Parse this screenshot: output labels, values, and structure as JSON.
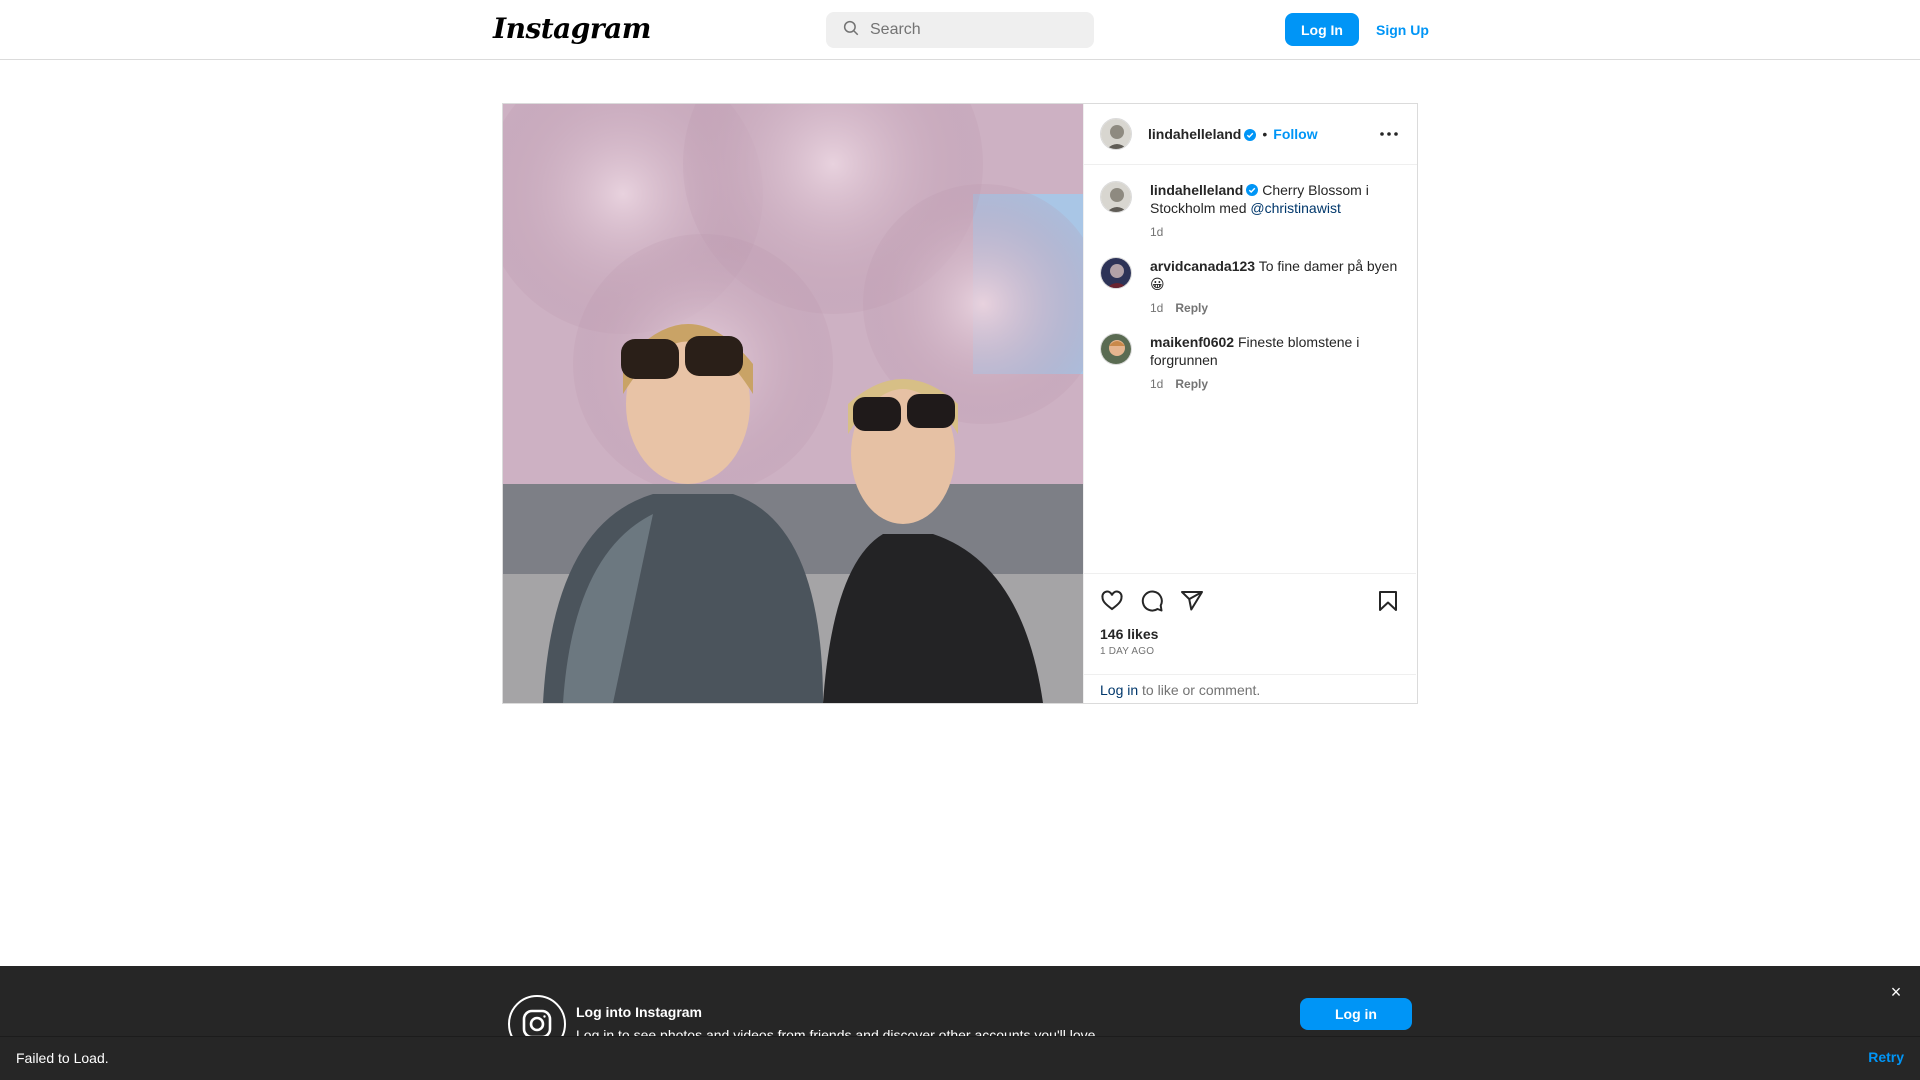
{
  "nav": {
    "logo": "Instagram",
    "search_placeholder": "Search",
    "login_label": "Log In",
    "signup_label": "Sign Up"
  },
  "post": {
    "author": "lindahelleland",
    "separator": "•",
    "follow_label": "Follow",
    "caption_text": "Cherry Blossom i Stockholm med",
    "caption_mention": "@christinawist",
    "caption_time": "1d",
    "comments": [
      {
        "user": "arvidcanada123",
        "text": "To fine damer på byen 😀",
        "time": "1d",
        "reply": "Reply"
      },
      {
        "user": "maikenf0602",
        "text": "Fineste blomstene i forgrunnen",
        "time": "1d",
        "reply": "Reply"
      }
    ],
    "likes": "146 likes",
    "time_ago": "1 DAY AGO",
    "login_link": "Log in",
    "login_rest": "to like or comment."
  },
  "banner": {
    "title": "Log into Instagram",
    "subtitle": "Log in to see photos and videos from friends and discover other accounts you'll love.",
    "login_label": "Log in",
    "close_label": "×"
  },
  "error": {
    "message": "Failed to Load.",
    "retry_label": "Retry"
  },
  "icons": {
    "search": "search-icon",
    "verified": "verified-badge-icon",
    "more": "more-options-icon",
    "like": "heart-icon",
    "comment": "comment-icon",
    "share": "share-icon",
    "save": "bookmark-icon",
    "instagram": "instagram-logo-icon"
  },
  "colors": {
    "accent": "#0095f6",
    "link": "#00376b",
    "banner_bg": "#262626"
  }
}
